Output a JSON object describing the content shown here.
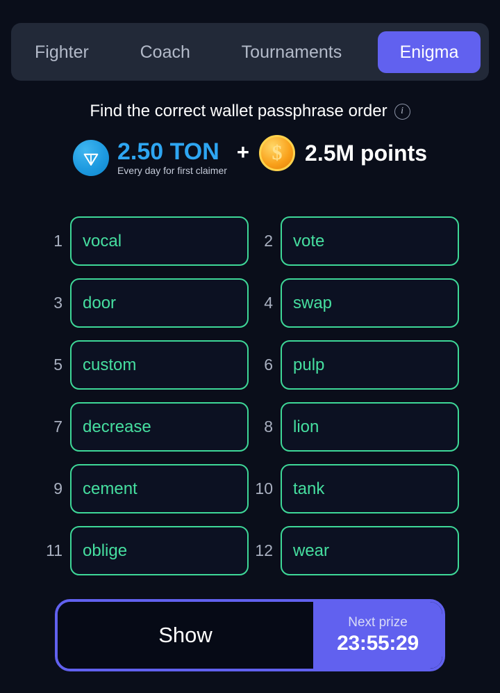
{
  "tabs": [
    {
      "label": "Fighter",
      "active": false
    },
    {
      "label": "Coach",
      "active": false
    },
    {
      "label": "Tournaments",
      "active": false
    },
    {
      "label": "Enigma",
      "active": true
    }
  ],
  "headline": {
    "text": "Find the correct wallet passphrase order",
    "info_icon": "info-icon"
  },
  "prize": {
    "ton_icon": "ton-coin-icon",
    "ton_amount": "2.50 TON",
    "ton_subtitle": "Every day for first claimer",
    "separator": "+",
    "points_icon": "gold-coin-icon",
    "points_amount": "2.5M points"
  },
  "passphrase": {
    "slots": [
      {
        "index": "1",
        "word": "vocal"
      },
      {
        "index": "2",
        "word": "vote"
      },
      {
        "index": "3",
        "word": "door"
      },
      {
        "index": "4",
        "word": "swap"
      },
      {
        "index": "5",
        "word": "custom"
      },
      {
        "index": "6",
        "word": "pulp"
      },
      {
        "index": "7",
        "word": "decrease"
      },
      {
        "index": "8",
        "word": "lion"
      },
      {
        "index": "9",
        "word": "cement"
      },
      {
        "index": "10",
        "word": "tank"
      },
      {
        "index": "11",
        "word": "oblige"
      },
      {
        "index": "12",
        "word": "wear"
      }
    ]
  },
  "actions": {
    "show_label": "Show",
    "next_prize_label": "Next prize",
    "next_prize_timer": "23:55:29"
  },
  "colors": {
    "background": "#0a0e1a",
    "tabbar": "#222938",
    "accent_purple": "#6161ef",
    "slot_green": "#3ed898",
    "ton_blue": "#2ea6f2",
    "coin_gold": "#f9a11b"
  }
}
